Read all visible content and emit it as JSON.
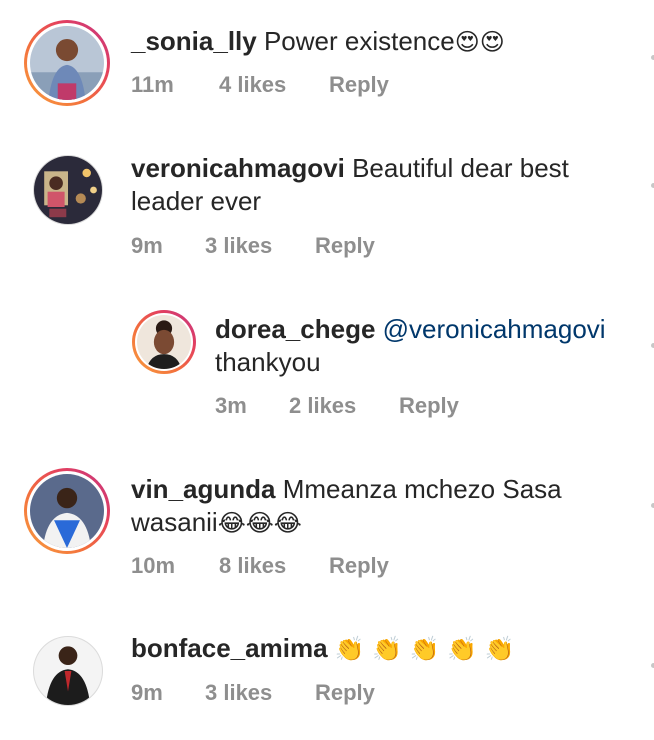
{
  "comments": [
    {
      "username": "_sonia_lly",
      "text": "Power existence",
      "emoji": "😍😍",
      "time": "11m",
      "likes": "4 likes",
      "reply": "Reply"
    },
    {
      "username": "veronicahmagovi",
      "text_line1": "Beautiful dear best",
      "text_line2": "leader ever",
      "time": "9m",
      "likes": "3 likes",
      "reply": "Reply"
    },
    {
      "username": "dorea_chege",
      "mention": "@veronicahmagovi",
      "text_line2": "thankyou",
      "time": "3m",
      "likes": "2 likes",
      "reply": "Reply"
    },
    {
      "username": "vin_agunda",
      "text_line1": "Mmeanza mchezo Sasa",
      "text_line2": "wasanii",
      "emoji": "😂😂😂",
      "time": "10m",
      "likes": "8 likes",
      "reply": "Reply"
    },
    {
      "username": "bonface_amima",
      "emoji": "👏 👏 👏 👏 👏",
      "time": "9m",
      "likes": "3 likes",
      "reply": "Reply"
    }
  ],
  "colors": {
    "text": "#262626",
    "meta": "#8e8e8e",
    "mention": "#00376b"
  }
}
